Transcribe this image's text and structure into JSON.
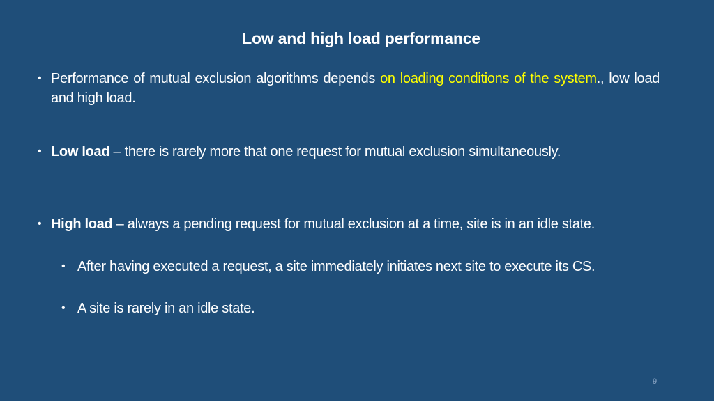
{
  "slide": {
    "title": "Low and high load performance",
    "bullets": [
      {
        "pre": "Performance of mutual exclusion algorithms depends ",
        "highlight": "on loading conditions of the system",
        "post": "., low load and high load."
      },
      {
        "bold": "Low load",
        "text": " – there is rarely more that one request for mutual exclusion simultaneously."
      },
      {
        "bold": "High load",
        "text": " – always a pending request for mutual exclusion at a time, site is  in an idle state.",
        "sub": [
          "After having executed a request, a site immediately initiates next site to execute its CS.",
          "A site is rarely in an idle state."
        ]
      }
    ],
    "bullet_glyph": "•",
    "page_number": "9",
    "colors": {
      "background": "#1f4e79",
      "text": "#ffffff",
      "highlight": "#ffff00"
    }
  }
}
